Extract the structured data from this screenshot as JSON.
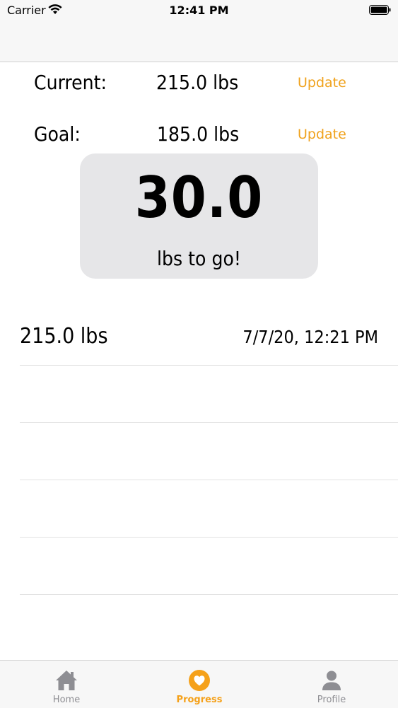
{
  "status_bar": {
    "carrier": "Carrier",
    "time": "12:41 PM"
  },
  "summary": {
    "current_label": "Current:",
    "current_value": "215.0 lbs",
    "goal_label": "Goal:",
    "goal_value": "185.0 lbs",
    "update_label": "Update"
  },
  "to_go": {
    "amount": "30.0",
    "caption": "lbs to go!"
  },
  "history": [
    {
      "weight": "215.0 lbs",
      "date": "7/7/20, 12:21 PM"
    },
    {
      "weight": "",
      "date": ""
    },
    {
      "weight": "",
      "date": ""
    },
    {
      "weight": "",
      "date": ""
    },
    {
      "weight": "",
      "date": ""
    }
  ],
  "tab_bar": {
    "tabs": [
      {
        "label": "Home",
        "icon": "house-icon",
        "active": false
      },
      {
        "label": "Progress",
        "icon": "heart-icon",
        "active": true
      },
      {
        "label": "Profile",
        "icon": "person-icon",
        "active": false
      }
    ],
    "active_color": "#f5a11a",
    "inactive_color": "#8e8e93"
  },
  "colors": {
    "accent": "#f0a21c",
    "card_bg": "#e6e6e8"
  }
}
